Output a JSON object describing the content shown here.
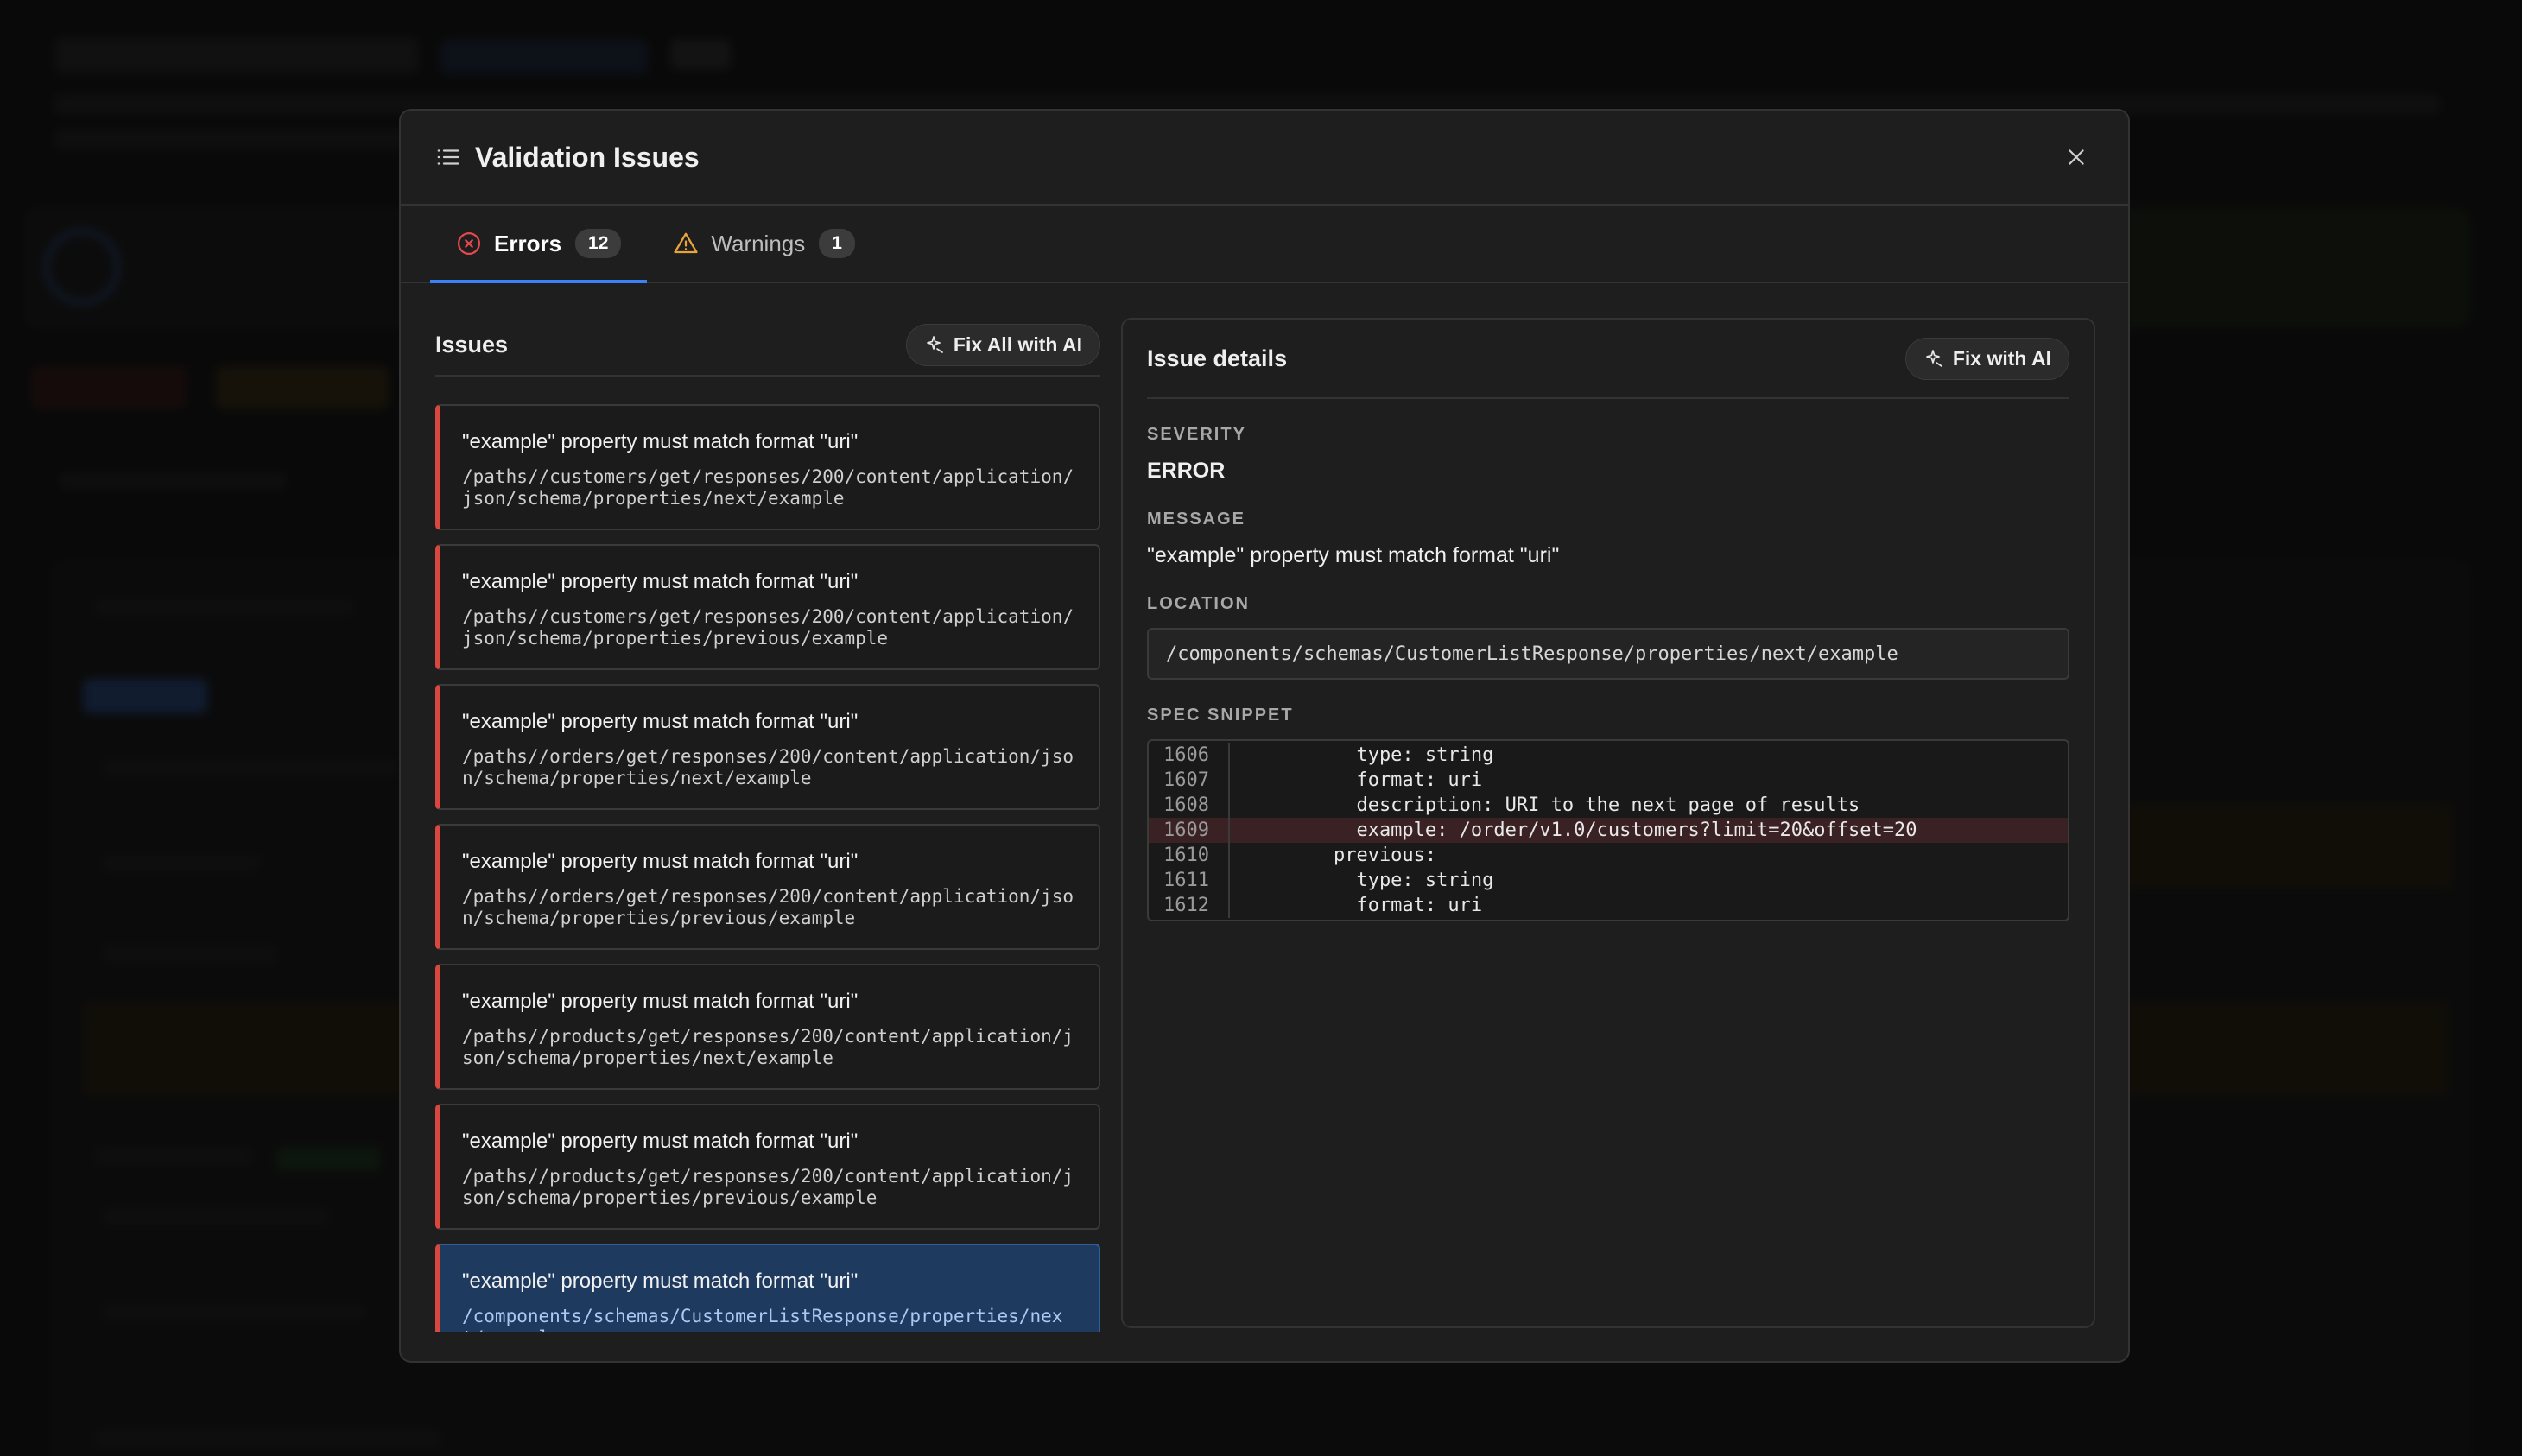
{
  "modal": {
    "title": "Validation Issues",
    "icon": "list-icon",
    "close_icon": "close-icon"
  },
  "tabs": [
    {
      "label": "Errors",
      "count": "12",
      "icon": "error-circle-icon",
      "active": true
    },
    {
      "label": "Warnings",
      "count": "1",
      "icon": "warning-triangle-icon",
      "active": false
    }
  ],
  "issues_panel": {
    "title": "Issues",
    "fix_all_label": "Fix All with AI",
    "items": [
      {
        "message": "\"example\" property must match format \"uri\"",
        "path": "/paths//customers/get/responses/200/content/application/json/schema/properties/next/example"
      },
      {
        "message": "\"example\" property must match format \"uri\"",
        "path": "/paths//customers/get/responses/200/content/application/json/schema/properties/previous/example"
      },
      {
        "message": "\"example\" property must match format \"uri\"",
        "path": "/paths//orders/get/responses/200/content/application/json/schema/properties/next/example"
      },
      {
        "message": "\"example\" property must match format \"uri\"",
        "path": "/paths//orders/get/responses/200/content/application/json/schema/properties/previous/example"
      },
      {
        "message": "\"example\" property must match format \"uri\"",
        "path": "/paths//products/get/responses/200/content/application/json/schema/properties/next/example"
      },
      {
        "message": "\"example\" property must match format \"uri\"",
        "path": "/paths//products/get/responses/200/content/application/json/schema/properties/previous/example"
      },
      {
        "message": "\"example\" property must match format \"uri\"",
        "path": "/components/schemas/CustomerListResponse/properties/next/example",
        "selected": true
      }
    ]
  },
  "detail": {
    "title": "Issue details",
    "fix_label": "Fix with AI",
    "severity_label": "SEVERITY",
    "severity": "ERROR",
    "message_label": "MESSAGE",
    "message": "\"example\" property must match format \"uri\"",
    "location_label": "LOCATION",
    "location": "/components/schemas/CustomerListResponse/properties/next/example",
    "snippet_label": "SPEC SNIPPET",
    "snippet": [
      {
        "line": "1606",
        "code": "          type: string"
      },
      {
        "line": "1607",
        "code": "          format: uri"
      },
      {
        "line": "1608",
        "code": "          description: URI to the next page of results"
      },
      {
        "line": "1609",
        "code": "          example: /order/v1.0/customers?limit=20&offset=20",
        "highlight": true
      },
      {
        "line": "1610",
        "code": "        previous:"
      },
      {
        "line": "1611",
        "code": "          type: string"
      },
      {
        "line": "1612",
        "code": "          format: uri"
      }
    ]
  },
  "colors": {
    "accent": "#3b82f6",
    "error": "#d9473f",
    "warning": "#e0a030",
    "selected": "#1f3a5f"
  }
}
